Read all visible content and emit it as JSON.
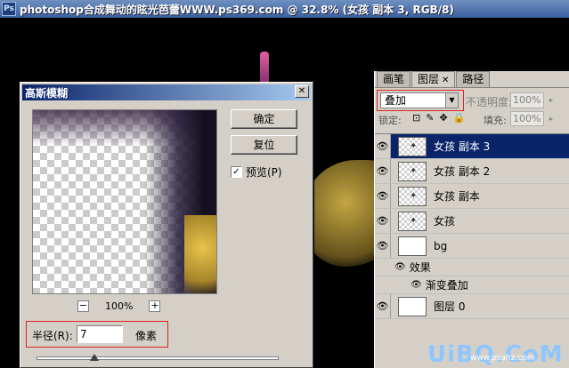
{
  "window": {
    "ps_icon": "Ps",
    "title": "photoshop合成舞动的眩光芭蕾WWW.ps369.com @ 32.8% (女孩 副本 3, RGB/8)"
  },
  "dialog": {
    "title": "高斯模糊",
    "close": "✕",
    "ok_label": "确定",
    "reset_label": "复位",
    "preview_label": "预览(P)",
    "preview_checked": "✓",
    "zoom_minus": "−",
    "zoom_level": "100%",
    "zoom_plus": "+",
    "radius_label": "半径(R):",
    "radius_value": "7",
    "radius_unit": "像素",
    "slider_level_fraction": 0.24
  },
  "layers_panel": {
    "tabs": [
      {
        "label": "画笔"
      },
      {
        "label": "图层",
        "close": "✕"
      },
      {
        "label": "路径"
      }
    ],
    "blend_mode": "叠加",
    "blend_arrow": "▼",
    "opacity_label": "不透明度:",
    "opacity_value": "100%",
    "opacity_arrow": "▸",
    "lock_label": "锁定:",
    "lock_icons": [
      "⊡",
      "✎",
      "✥",
      "🔒"
    ],
    "fill_label": "填充:",
    "fill_value": "100%",
    "fill_arrow": "▸",
    "eye_glyph": "👁",
    "layers": [
      {
        "name": "女孩 副本 3",
        "selected": true
      },
      {
        "name": "女孩 副本 2"
      },
      {
        "name": "女孩 副本"
      },
      {
        "name": "女孩"
      },
      {
        "name": "bg"
      },
      {
        "name": "效果",
        "sub": true
      },
      {
        "name": "渐变叠加",
        "sub": true,
        "inner": true
      },
      {
        "name": "图层 0"
      }
    ]
  },
  "watermark": {
    "brand": "UiBQ.CoM",
    "site": "www.psahz.com"
  },
  "colors": {
    "selection": "#0a246a",
    "highlight_box": "#e02020",
    "dialog_bg": "#d4d0c8"
  }
}
